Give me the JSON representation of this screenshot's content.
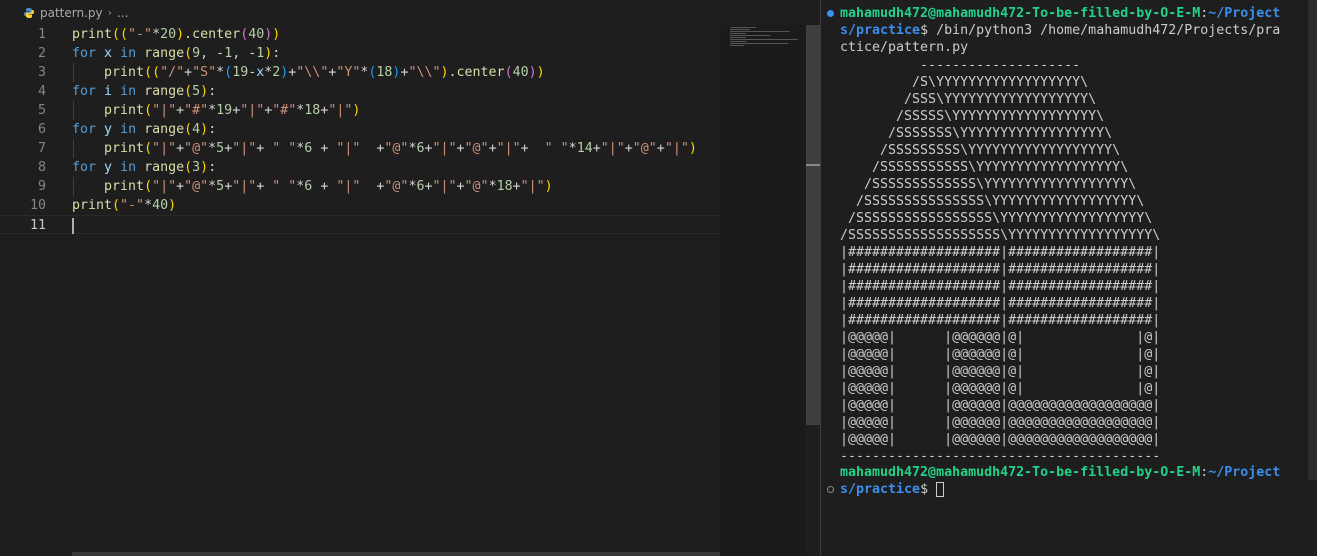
{
  "breadcrumb": {
    "file_name": "pattern.py",
    "separator": "›",
    "ellipsis": "..."
  },
  "editor": {
    "active_line": 11,
    "lines": [
      {
        "n": "1",
        "tokens": [
          [
            "fn",
            "print"
          ],
          [
            "b1",
            "(("
          ],
          [
            "st",
            "\"-\""
          ],
          [
            "op",
            "*"
          ],
          [
            "nm",
            "20"
          ],
          [
            "b1",
            ")"
          ],
          [
            "op",
            "."
          ],
          [
            "fn",
            "center"
          ],
          [
            "b2",
            "("
          ],
          [
            "nm",
            "40"
          ],
          [
            "b2",
            ")"
          ],
          [
            "b1",
            ")"
          ]
        ]
      },
      {
        "n": "2",
        "tokens": [
          [
            "kw",
            "for"
          ],
          [
            "op",
            " "
          ],
          [
            "vr",
            "x"
          ],
          [
            "op",
            " "
          ],
          [
            "kw",
            "in"
          ],
          [
            "op",
            " "
          ],
          [
            "fn",
            "range"
          ],
          [
            "b1",
            "("
          ],
          [
            "nm",
            "9"
          ],
          [
            "op",
            ", -"
          ],
          [
            "nm",
            "1"
          ],
          [
            "op",
            ", -"
          ],
          [
            "nm",
            "1"
          ],
          [
            "b1",
            ")"
          ],
          [
            "op",
            ":"
          ]
        ]
      },
      {
        "n": "3",
        "indent": true,
        "tokens": [
          [
            "op",
            "    "
          ],
          [
            "fn",
            "print"
          ],
          [
            "b1",
            "(("
          ],
          [
            "st",
            "\"/\""
          ],
          [
            "op",
            "+"
          ],
          [
            "st",
            "\"S\""
          ],
          [
            "op",
            "*"
          ],
          [
            "b3",
            "("
          ],
          [
            "nm",
            "19"
          ],
          [
            "op",
            "-"
          ],
          [
            "vr",
            "x"
          ],
          [
            "op",
            "*"
          ],
          [
            "nm",
            "2"
          ],
          [
            "b3",
            ")"
          ],
          [
            "op",
            "+"
          ],
          [
            "st",
            "\"\\\\\""
          ],
          [
            "op",
            "+"
          ],
          [
            "st",
            "\"Y\""
          ],
          [
            "op",
            "*"
          ],
          [
            "b3",
            "("
          ],
          [
            "nm",
            "18"
          ],
          [
            "b3",
            ")"
          ],
          [
            "op",
            "+"
          ],
          [
            "st",
            "\"\\\\\""
          ],
          [
            "b1",
            ")"
          ],
          [
            "op",
            "."
          ],
          [
            "fn",
            "center"
          ],
          [
            "b2",
            "("
          ],
          [
            "nm",
            "40"
          ],
          [
            "b2",
            ")"
          ],
          [
            "b1",
            ")"
          ]
        ]
      },
      {
        "n": "4",
        "tokens": [
          [
            "kw",
            "for"
          ],
          [
            "op",
            " "
          ],
          [
            "vr",
            "i"
          ],
          [
            "op",
            " "
          ],
          [
            "kw",
            "in"
          ],
          [
            "op",
            " "
          ],
          [
            "fn",
            "range"
          ],
          [
            "b1",
            "("
          ],
          [
            "nm",
            "5"
          ],
          [
            "b1",
            ")"
          ],
          [
            "op",
            ":"
          ]
        ]
      },
      {
        "n": "5",
        "indent": true,
        "tokens": [
          [
            "op",
            "    "
          ],
          [
            "fn",
            "print"
          ],
          [
            "b1",
            "("
          ],
          [
            "st",
            "\"|\""
          ],
          [
            "op",
            "+"
          ],
          [
            "st",
            "\"#\""
          ],
          [
            "op",
            "*"
          ],
          [
            "nm",
            "19"
          ],
          [
            "op",
            "+"
          ],
          [
            "st",
            "\"|\""
          ],
          [
            "op",
            "+"
          ],
          [
            "st",
            "\"#\""
          ],
          [
            "op",
            "*"
          ],
          [
            "nm",
            "18"
          ],
          [
            "op",
            "+"
          ],
          [
            "st",
            "\"|\""
          ],
          [
            "b1",
            ")"
          ]
        ]
      },
      {
        "n": "6",
        "tokens": [
          [
            "kw",
            "for"
          ],
          [
            "op",
            " "
          ],
          [
            "vr",
            "y"
          ],
          [
            "op",
            " "
          ],
          [
            "kw",
            "in"
          ],
          [
            "op",
            " "
          ],
          [
            "fn",
            "range"
          ],
          [
            "b1",
            "("
          ],
          [
            "nm",
            "4"
          ],
          [
            "b1",
            ")"
          ],
          [
            "op",
            ":"
          ]
        ]
      },
      {
        "n": "7",
        "indent": true,
        "tokens": [
          [
            "op",
            "    "
          ],
          [
            "fn",
            "print"
          ],
          [
            "b1",
            "("
          ],
          [
            "st",
            "\"|\""
          ],
          [
            "op",
            "+"
          ],
          [
            "st",
            "\"@\""
          ],
          [
            "op",
            "*"
          ],
          [
            "nm",
            "5"
          ],
          [
            "op",
            "+"
          ],
          [
            "st",
            "\"|\""
          ],
          [
            "op",
            "+ "
          ],
          [
            "st",
            "\" \""
          ],
          [
            "op",
            "*"
          ],
          [
            "nm",
            "6"
          ],
          [
            "op",
            " + "
          ],
          [
            "st",
            "\"|\""
          ],
          [
            "op",
            "  +"
          ],
          [
            "st",
            "\"@\""
          ],
          [
            "op",
            "*"
          ],
          [
            "nm",
            "6"
          ],
          [
            "op",
            "+"
          ],
          [
            "st",
            "\"|\""
          ],
          [
            "op",
            "+"
          ],
          [
            "st",
            "\"@\""
          ],
          [
            "op",
            "+"
          ],
          [
            "st",
            "\"|\""
          ],
          [
            "op",
            "+"
          ],
          [
            "op",
            "  "
          ],
          [
            "st",
            "\" \""
          ],
          [
            "op",
            "*"
          ],
          [
            "nm",
            "14"
          ],
          [
            "op",
            "+"
          ],
          [
            "st",
            "\"|\""
          ],
          [
            "op",
            "+"
          ],
          [
            "st",
            "\"@\""
          ],
          [
            "op",
            "+"
          ],
          [
            "st",
            "\"|\""
          ],
          [
            "b1",
            ")"
          ]
        ]
      },
      {
        "n": "8",
        "tokens": [
          [
            "kw",
            "for"
          ],
          [
            "op",
            " "
          ],
          [
            "vr",
            "y"
          ],
          [
            "op",
            " "
          ],
          [
            "kw",
            "in"
          ],
          [
            "op",
            " "
          ],
          [
            "fn",
            "range"
          ],
          [
            "b1",
            "("
          ],
          [
            "nm",
            "3"
          ],
          [
            "b1",
            ")"
          ],
          [
            "op",
            ":"
          ]
        ]
      },
      {
        "n": "9",
        "indent": true,
        "tokens": [
          [
            "op",
            "    "
          ],
          [
            "fn",
            "print"
          ],
          [
            "b1",
            "("
          ],
          [
            "st",
            "\"|\""
          ],
          [
            "op",
            "+"
          ],
          [
            "st",
            "\"@\""
          ],
          [
            "op",
            "*"
          ],
          [
            "nm",
            "5"
          ],
          [
            "op",
            "+"
          ],
          [
            "st",
            "\"|\""
          ],
          [
            "op",
            "+ "
          ],
          [
            "st",
            "\" \""
          ],
          [
            "op",
            "*"
          ],
          [
            "nm",
            "6"
          ],
          [
            "op",
            " + "
          ],
          [
            "st",
            "\"|\""
          ],
          [
            "op",
            "  +"
          ],
          [
            "st",
            "\"@\""
          ],
          [
            "op",
            "*"
          ],
          [
            "nm",
            "6"
          ],
          [
            "op",
            "+"
          ],
          [
            "st",
            "\"|\""
          ],
          [
            "op",
            "+"
          ],
          [
            "st",
            "\"@\""
          ],
          [
            "op",
            "*"
          ],
          [
            "nm",
            "18"
          ],
          [
            "op",
            "+"
          ],
          [
            "st",
            "\"|\""
          ],
          [
            "b1",
            ")"
          ]
        ]
      },
      {
        "n": "10",
        "tokens": [
          [
            "fn",
            "print"
          ],
          [
            "b1",
            "("
          ],
          [
            "st",
            "\"-\""
          ],
          [
            "op",
            "*"
          ],
          [
            "nm",
            "40"
          ],
          [
            "b1",
            ")"
          ]
        ]
      },
      {
        "n": "11",
        "tokens": []
      }
    ]
  },
  "terminal": {
    "prompt_user": "mahamudh472@mahamudh472-To-be-filled-by-O-E-M",
    "prompt_colon": ":",
    "prompt_path_1": "~/Project",
    "prompt_path_2": "s/practice",
    "prompt_symbol": "$",
    "command_1": " /bin/python3 /home/mahamudh472/Projects/pra",
    "command_2": "ctice/pattern.py",
    "output": [
      "          --------------------",
      "         /S\\YYYYYYYYYYYYYYYYYY\\",
      "        /SSS\\YYYYYYYYYYYYYYYYYY\\",
      "       /SSSSS\\YYYYYYYYYYYYYYYYYY\\",
      "      /SSSSSSS\\YYYYYYYYYYYYYYYYYY\\",
      "     /SSSSSSSSS\\YYYYYYYYYYYYYYYYYY\\",
      "    /SSSSSSSSSSS\\YYYYYYYYYYYYYYYYYY\\",
      "   /SSSSSSSSSSSSS\\YYYYYYYYYYYYYYYYYY\\",
      "  /SSSSSSSSSSSSSSS\\YYYYYYYYYYYYYYYYYY\\",
      " /SSSSSSSSSSSSSSSSS\\YYYYYYYYYYYYYYYYYY\\",
      "/SSSSSSSSSSSSSSSSSSS\\YYYYYYYYYYYYYYYYYY\\",
      "|###################|##################|",
      "|###################|##################|",
      "|###################|##################|",
      "|###################|##################|",
      "|###################|##################|",
      "|@@@@@|      |@@@@@@|@|              |@|",
      "|@@@@@|      |@@@@@@|@|              |@|",
      "|@@@@@|      |@@@@@@|@|              |@|",
      "|@@@@@|      |@@@@@@|@|              |@|",
      "|@@@@@|      |@@@@@@|@@@@@@@@@@@@@@@@@@|",
      "|@@@@@|      |@@@@@@|@@@@@@@@@@@@@@@@@@|",
      "|@@@@@|      |@@@@@@|@@@@@@@@@@@@@@@@@@|",
      "----------------------------------------"
    ]
  }
}
